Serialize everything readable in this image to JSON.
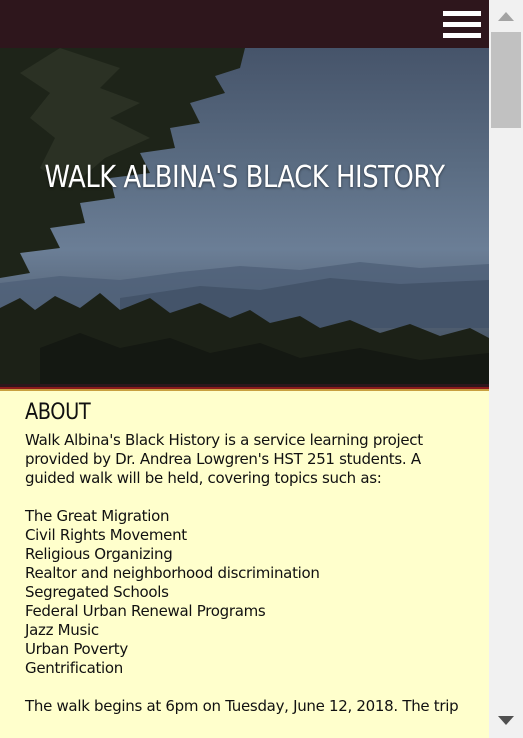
{
  "header": {
    "menu_icon": "hamburger-menu-icon"
  },
  "hero": {
    "title": "WALK ALBINA'S BLACK HISTORY"
  },
  "about": {
    "heading": "ABOUT",
    "intro": "Walk Albina's Black History is a service learning project provided by Dr. Andrea Lowgren's HST 251 students. A guided walk will be held, covering topics such as:",
    "topics": [
      "The Great Migration",
      "Civil Rights Movement",
      "Religious Organizing",
      "Realtor and neighborhood discrimination",
      "Segregated Schools",
      "Federal Urban Renewal Programs",
      "Jazz Music",
      "Urban Poverty",
      "Gentrification"
    ],
    "walk_text": "The walk begins at 6pm on Tuesday, June 12, 2018. The trip"
  },
  "colors": {
    "topbar": "#2e161c",
    "content_bg": "#ffffcc",
    "stripe_dark": "#2e161c",
    "stripe_red": "#8b1a1a",
    "stripe_gold": "#c8a040"
  },
  "scrollbar": {
    "up_icon": "scroll-up-arrow-icon",
    "down_icon": "scroll-down-arrow-icon"
  }
}
